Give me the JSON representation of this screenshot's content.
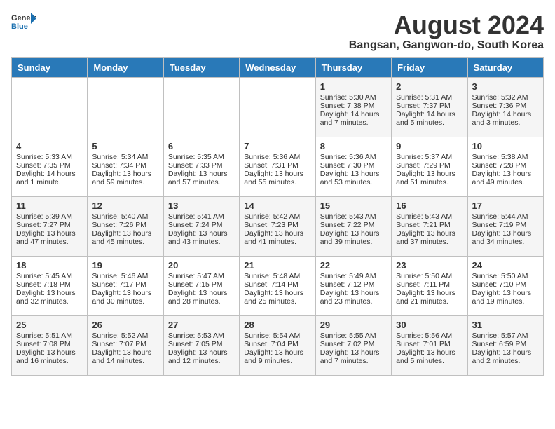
{
  "header": {
    "logo_line1": "General",
    "logo_line2": "Blue",
    "month_year": "August 2024",
    "location": "Bangsan, Gangwon-do, South Korea"
  },
  "days_of_week": [
    "Sunday",
    "Monday",
    "Tuesday",
    "Wednesday",
    "Thursday",
    "Friday",
    "Saturday"
  ],
  "weeks": [
    [
      {
        "day": "",
        "info": ""
      },
      {
        "day": "",
        "info": ""
      },
      {
        "day": "",
        "info": ""
      },
      {
        "day": "",
        "info": ""
      },
      {
        "day": "1",
        "info": "Sunrise: 5:30 AM\nSunset: 7:38 PM\nDaylight: 14 hours\nand 7 minutes."
      },
      {
        "day": "2",
        "info": "Sunrise: 5:31 AM\nSunset: 7:37 PM\nDaylight: 14 hours\nand 5 minutes."
      },
      {
        "day": "3",
        "info": "Sunrise: 5:32 AM\nSunset: 7:36 PM\nDaylight: 14 hours\nand 3 minutes."
      }
    ],
    [
      {
        "day": "4",
        "info": "Sunrise: 5:33 AM\nSunset: 7:35 PM\nDaylight: 14 hours\nand 1 minute."
      },
      {
        "day": "5",
        "info": "Sunrise: 5:34 AM\nSunset: 7:34 PM\nDaylight: 13 hours\nand 59 minutes."
      },
      {
        "day": "6",
        "info": "Sunrise: 5:35 AM\nSunset: 7:33 PM\nDaylight: 13 hours\nand 57 minutes."
      },
      {
        "day": "7",
        "info": "Sunrise: 5:36 AM\nSunset: 7:31 PM\nDaylight: 13 hours\nand 55 minutes."
      },
      {
        "day": "8",
        "info": "Sunrise: 5:36 AM\nSunset: 7:30 PM\nDaylight: 13 hours\nand 53 minutes."
      },
      {
        "day": "9",
        "info": "Sunrise: 5:37 AM\nSunset: 7:29 PM\nDaylight: 13 hours\nand 51 minutes."
      },
      {
        "day": "10",
        "info": "Sunrise: 5:38 AM\nSunset: 7:28 PM\nDaylight: 13 hours\nand 49 minutes."
      }
    ],
    [
      {
        "day": "11",
        "info": "Sunrise: 5:39 AM\nSunset: 7:27 PM\nDaylight: 13 hours\nand 47 minutes."
      },
      {
        "day": "12",
        "info": "Sunrise: 5:40 AM\nSunset: 7:26 PM\nDaylight: 13 hours\nand 45 minutes."
      },
      {
        "day": "13",
        "info": "Sunrise: 5:41 AM\nSunset: 7:24 PM\nDaylight: 13 hours\nand 43 minutes."
      },
      {
        "day": "14",
        "info": "Sunrise: 5:42 AM\nSunset: 7:23 PM\nDaylight: 13 hours\nand 41 minutes."
      },
      {
        "day": "15",
        "info": "Sunrise: 5:43 AM\nSunset: 7:22 PM\nDaylight: 13 hours\nand 39 minutes."
      },
      {
        "day": "16",
        "info": "Sunrise: 5:43 AM\nSunset: 7:21 PM\nDaylight: 13 hours\nand 37 minutes."
      },
      {
        "day": "17",
        "info": "Sunrise: 5:44 AM\nSunset: 7:19 PM\nDaylight: 13 hours\nand 34 minutes."
      }
    ],
    [
      {
        "day": "18",
        "info": "Sunrise: 5:45 AM\nSunset: 7:18 PM\nDaylight: 13 hours\nand 32 minutes."
      },
      {
        "day": "19",
        "info": "Sunrise: 5:46 AM\nSunset: 7:17 PM\nDaylight: 13 hours\nand 30 minutes."
      },
      {
        "day": "20",
        "info": "Sunrise: 5:47 AM\nSunset: 7:15 PM\nDaylight: 13 hours\nand 28 minutes."
      },
      {
        "day": "21",
        "info": "Sunrise: 5:48 AM\nSunset: 7:14 PM\nDaylight: 13 hours\nand 25 minutes."
      },
      {
        "day": "22",
        "info": "Sunrise: 5:49 AM\nSunset: 7:12 PM\nDaylight: 13 hours\nand 23 minutes."
      },
      {
        "day": "23",
        "info": "Sunrise: 5:50 AM\nSunset: 7:11 PM\nDaylight: 13 hours\nand 21 minutes."
      },
      {
        "day": "24",
        "info": "Sunrise: 5:50 AM\nSunset: 7:10 PM\nDaylight: 13 hours\nand 19 minutes."
      }
    ],
    [
      {
        "day": "25",
        "info": "Sunrise: 5:51 AM\nSunset: 7:08 PM\nDaylight: 13 hours\nand 16 minutes."
      },
      {
        "day": "26",
        "info": "Sunrise: 5:52 AM\nSunset: 7:07 PM\nDaylight: 13 hours\nand 14 minutes."
      },
      {
        "day": "27",
        "info": "Sunrise: 5:53 AM\nSunset: 7:05 PM\nDaylight: 13 hours\nand 12 minutes."
      },
      {
        "day": "28",
        "info": "Sunrise: 5:54 AM\nSunset: 7:04 PM\nDaylight: 13 hours\nand 9 minutes."
      },
      {
        "day": "29",
        "info": "Sunrise: 5:55 AM\nSunset: 7:02 PM\nDaylight: 13 hours\nand 7 minutes."
      },
      {
        "day": "30",
        "info": "Sunrise: 5:56 AM\nSunset: 7:01 PM\nDaylight: 13 hours\nand 5 minutes."
      },
      {
        "day": "31",
        "info": "Sunrise: 5:57 AM\nSunset: 6:59 PM\nDaylight: 13 hours\nand 2 minutes."
      }
    ]
  ]
}
